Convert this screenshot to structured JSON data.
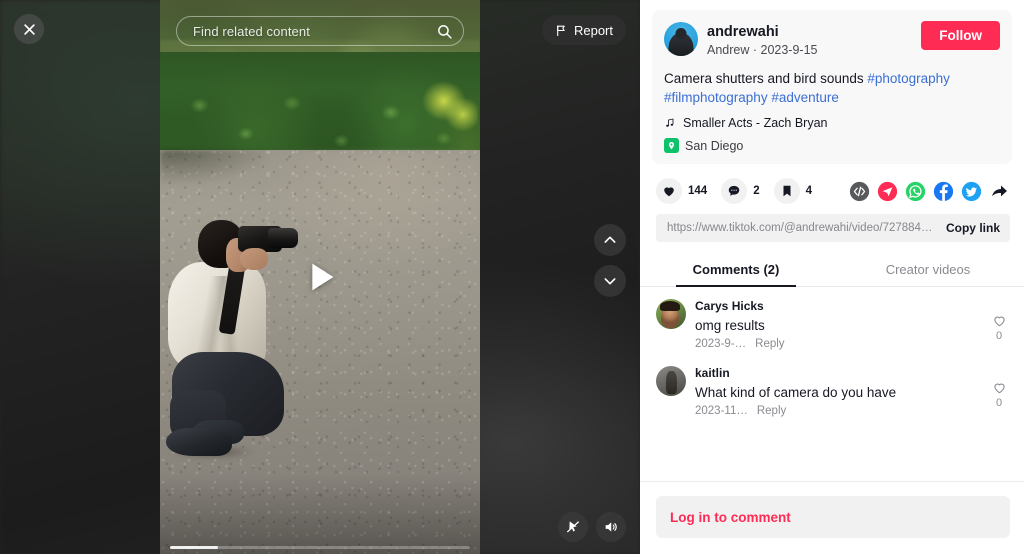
{
  "video": {
    "search_placeholder": "Find related content",
    "search_icon": "search-icon",
    "close_icon": "close-icon",
    "report_label": "Report",
    "report_icon": "flag-icon",
    "prev_icon": "chevron-up-icon",
    "next_icon": "chevron-down-icon",
    "play_icon": "play-icon",
    "clear_mode_icon": "clear-display-icon",
    "volume_icon": "volume-on-icon"
  },
  "author": {
    "handle": "andrewahi",
    "subtitle": "Andrew · 2023-9-15",
    "follow_label": "Follow",
    "follow_color": "#fe2c55",
    "avatar_name": "author-avatar"
  },
  "post": {
    "caption_text": "Camera shutters and bird sounds ",
    "hashtags": [
      "#photography",
      "#filmphotography",
      "#adventure"
    ],
    "music_icon": "music-note-icon",
    "music": "Smaller Acts - Zach Bryan",
    "location_icon": "location-pin-icon",
    "location": "San Diego",
    "location_badge_color": "#0ec26b"
  },
  "engagement": {
    "like_icon": "heart-icon",
    "like_count": "144",
    "comment_icon": "comment-bubble-icon",
    "comment_count": "2",
    "bookmark_icon": "bookmark-icon",
    "bookmark_count": "4",
    "share_icons": [
      {
        "name": "embed-code-icon",
        "label": "Embed",
        "color": "#58595c"
      },
      {
        "name": "telegram-icon",
        "label": "Telegram",
        "color": "#fe2c55"
      },
      {
        "name": "whatsapp-icon",
        "label": "WhatsApp",
        "color": "#25d366"
      },
      {
        "name": "facebook-icon",
        "label": "Facebook",
        "color": "#1877f2"
      },
      {
        "name": "twitter-icon",
        "label": "Twitter",
        "color": "#1da1f2"
      },
      {
        "name": "share-arrow-icon",
        "label": "Share",
        "color": "#161823"
      }
    ]
  },
  "link": {
    "url": "https://www.tiktok.com/@andrewahi/video/727884839…",
    "copy_label": "Copy link"
  },
  "tabs": [
    {
      "label": "Comments (2)",
      "active": true
    },
    {
      "label": "Creator videos",
      "active": false
    }
  ],
  "comments": [
    {
      "name": "Carys Hicks",
      "text": "omg results",
      "time": "2023-9-…",
      "reply_label": "Reply",
      "like_icon": "heart-outline-icon",
      "like_count": "0"
    },
    {
      "name": "kaitlin",
      "text": "What kind of camera do you have",
      "time": "2023-11…",
      "reply_label": "Reply",
      "like_icon": "heart-outline-icon",
      "like_count": "0"
    }
  ],
  "footer": {
    "login_label": "Log in to comment",
    "login_color": "#fe2c55"
  }
}
